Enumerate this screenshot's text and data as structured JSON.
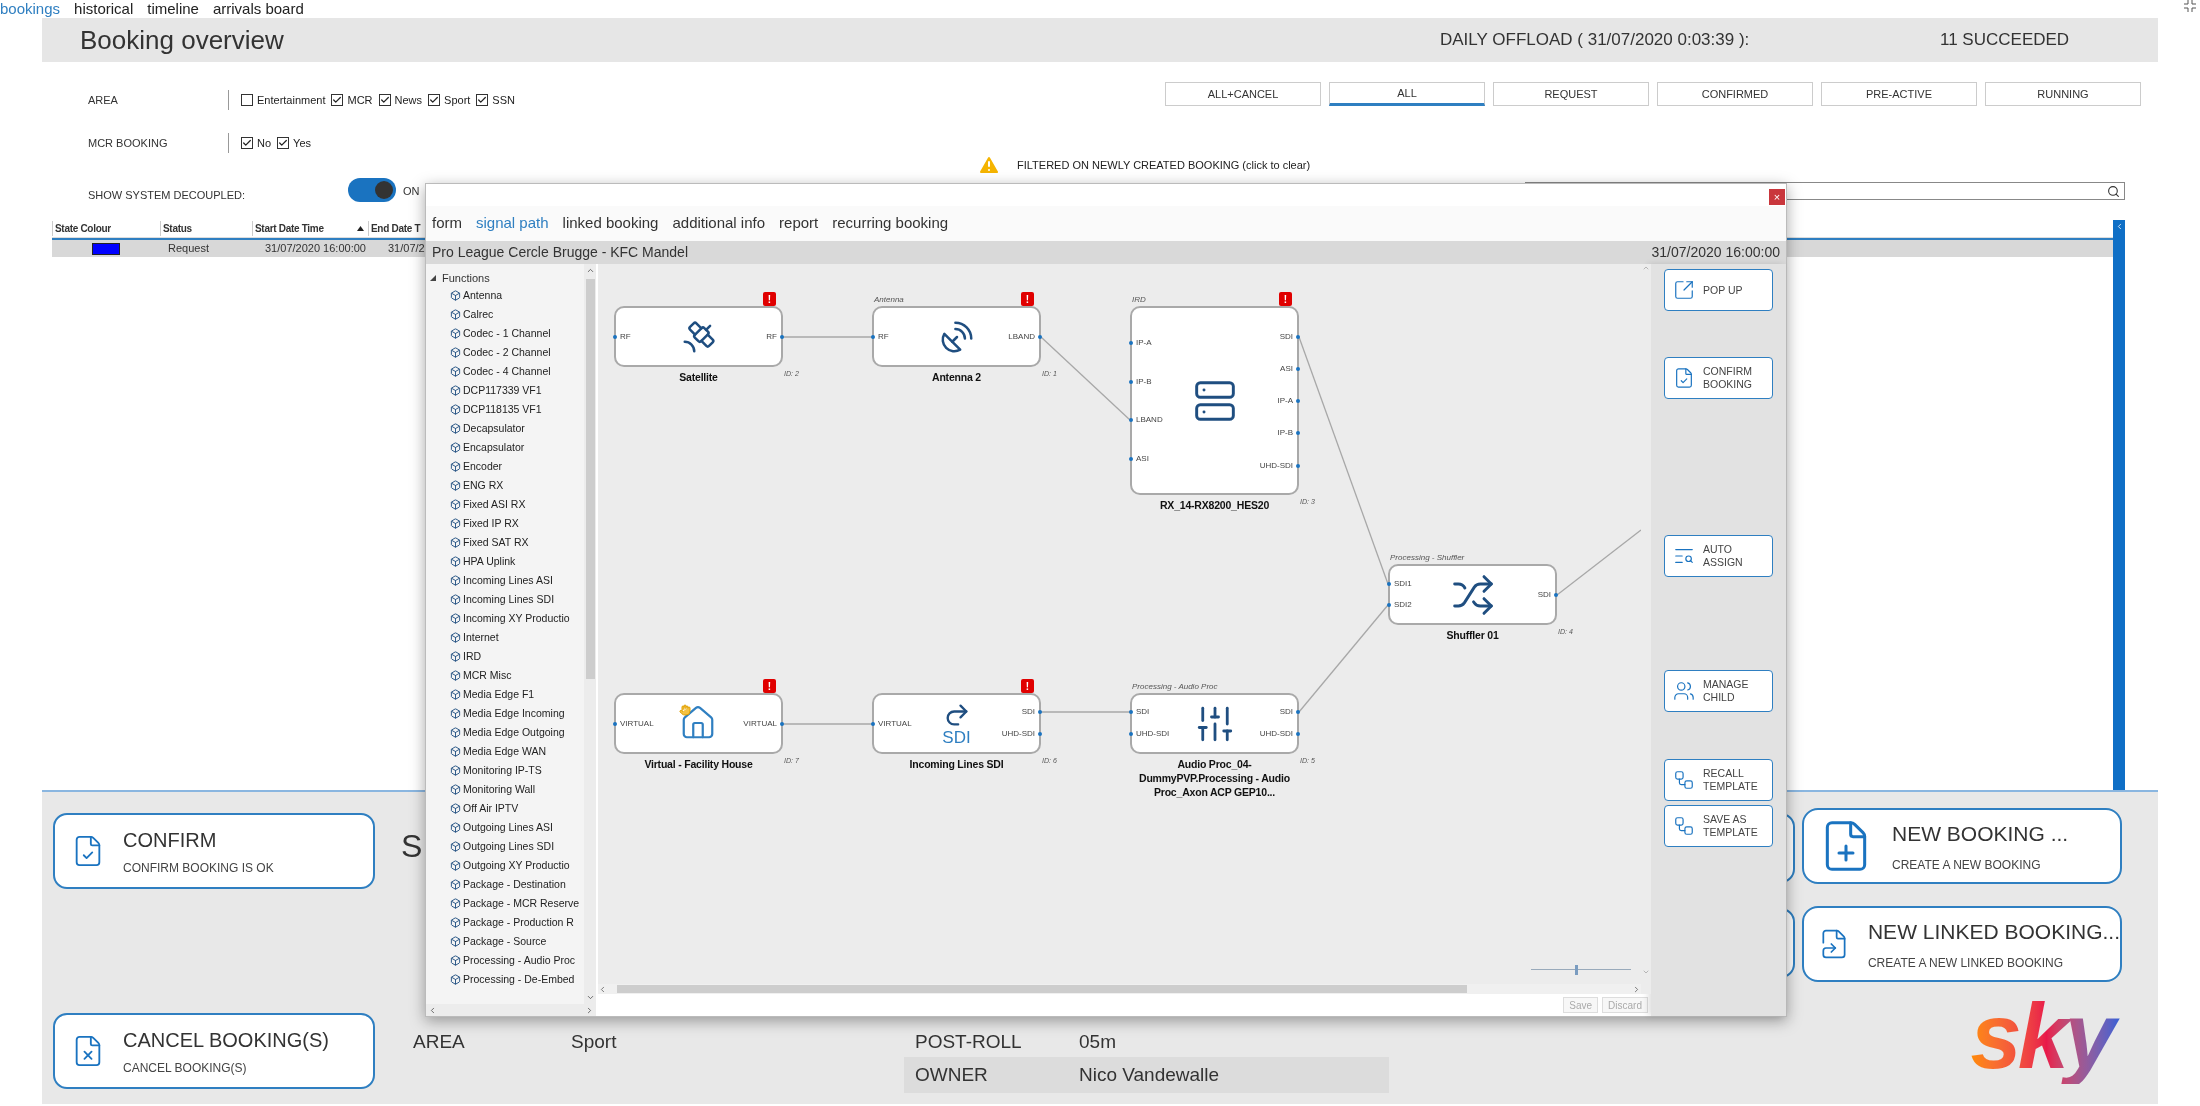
{
  "nav": [
    {
      "label": "bookings",
      "selected": true
    },
    {
      "label": "historical",
      "selected": false
    },
    {
      "label": "timeline",
      "selected": false
    },
    {
      "label": "arrivals board",
      "selected": false
    }
  ],
  "header": {
    "title": "Booking overview",
    "offload": "DAILY OFFLOAD ( 31/07/2020 0:03:39 ):",
    "succeeded": "11 SUCCEEDED"
  },
  "filters": [
    {
      "label": "AREA",
      "options": [
        {
          "label": "Entertainment",
          "checked": false
        },
        {
          "label": "MCR",
          "checked": true
        },
        {
          "label": "News",
          "checked": true
        },
        {
          "label": "Sport",
          "checked": true
        },
        {
          "label": "SSN",
          "checked": true
        }
      ]
    },
    {
      "label": "MCR BOOKING",
      "options": [
        {
          "label": "No",
          "checked": true
        },
        {
          "label": "Yes",
          "checked": true
        }
      ]
    }
  ],
  "decoupled": {
    "label": "SHOW SYSTEM DECOUPLED:",
    "on": true,
    "state_text": "ON"
  },
  "status_tabs": [
    {
      "label": "ALL+CANCEL",
      "selected": false
    },
    {
      "label": "ALL",
      "selected": true
    },
    {
      "label": "REQUEST",
      "selected": false
    },
    {
      "label": "CONFIRMED",
      "selected": false
    },
    {
      "label": "PRE-ACTIVE",
      "selected": false
    },
    {
      "label": "RUNNING",
      "selected": false
    }
  ],
  "notice": "FILTERED ON NEWLY CREATED BOOKING (click to clear)",
  "table": {
    "columns": [
      {
        "label": "State Colour",
        "sorted": false
      },
      {
        "label": "Status",
        "sorted": false
      },
      {
        "label": "Start Date Time",
        "sorted": true
      },
      {
        "label": "End Date T"
      }
    ],
    "rows": [
      {
        "selected": true,
        "cells": [
          {
            "kind": "swatch",
            "color": "#0000ff"
          },
          {
            "kind": "text",
            "text": "Request"
          },
          {
            "kind": "text",
            "text": "31/07/2020 16:00:00"
          },
          {
            "kind": "text",
            "text": "31/07/2"
          }
        ]
      }
    ]
  },
  "actions_left": [
    {
      "kind": "confirm",
      "title": "CONFIRM",
      "subtitle": "CONFIRM BOOKING IS OK"
    },
    {
      "kind": "cancel",
      "title": "CANCEL BOOKING(S)",
      "subtitle": "CANCEL BOOKING(S)"
    }
  ],
  "summary_heading": "S",
  "details": [
    {
      "label": "AREA",
      "value": "Sport"
    },
    {
      "label": "POST-ROLL",
      "value": "05m"
    },
    {
      "label": "OWNER",
      "value": "Nico Vandewalle"
    }
  ],
  "actions_right": [
    {
      "kind": "new",
      "title": "NEW BOOKING ...",
      "subtitle": "CREATE A NEW BOOKING"
    },
    {
      "kind": "linked",
      "title": "NEW LINKED BOOKING...",
      "subtitle": "CREATE A NEW LINKED BOOKING"
    }
  ],
  "logo": "sky",
  "dialog": {
    "close": "×",
    "tabs": [
      {
        "label": "form",
        "selected": false
      },
      {
        "label": "signal path",
        "selected": true
      },
      {
        "label": "linked booking",
        "selected": false
      },
      {
        "label": "additional info",
        "selected": false
      },
      {
        "label": "report",
        "selected": false
      },
      {
        "label": "recurring booking",
        "selected": false
      }
    ],
    "title": "Pro League Cercle Brugge - KFC Mandel",
    "date": "31/07/2020 16:00:00",
    "tree": {
      "label": "Functions",
      "expanded": true,
      "children": [
        {
          "label": "Antenna"
        },
        {
          "label": "Calrec"
        },
        {
          "label": "Codec - 1 Channel"
        },
        {
          "label": "Codec - 2 Channel"
        },
        {
          "label": "Codec - 4 Channel"
        },
        {
          "label": "DCP117339 VF1"
        },
        {
          "label": "DCP118135 VF1"
        },
        {
          "label": "Decapsulator"
        },
        {
          "label": "Encapsulator"
        },
        {
          "label": "Encoder"
        },
        {
          "label": "ENG RX"
        },
        {
          "label": "Fixed ASI RX"
        },
        {
          "label": "Fixed IP RX"
        },
        {
          "label": "Fixed SAT RX"
        },
        {
          "label": "HPA Uplink"
        },
        {
          "label": "Incoming Lines ASI"
        },
        {
          "label": "Incoming Lines SDI"
        },
        {
          "label": "Incoming XY Productio"
        },
        {
          "label": "Internet"
        },
        {
          "label": "IRD"
        },
        {
          "label": "MCR Misc"
        },
        {
          "label": "Media Edge F1"
        },
        {
          "label": "Media Edge Incoming"
        },
        {
          "label": "Media Edge Outgoing"
        },
        {
          "label": "Media Edge WAN"
        },
        {
          "label": "Monitoring IP-TS"
        },
        {
          "label": "Monitoring Wall"
        },
        {
          "label": "Off Air IPTV"
        },
        {
          "label": "Outgoing Lines ASI"
        },
        {
          "label": "Outgoing Lines SDI"
        },
        {
          "label": "Outgoing XY Productio"
        },
        {
          "label": "Package - Destination"
        },
        {
          "label": "Package - MCR Reserve"
        },
        {
          "label": "Package - Production R"
        },
        {
          "label": "Package - Source"
        },
        {
          "label": "Processing - Audio Proc"
        },
        {
          "label": "Processing - De-Embed"
        }
      ]
    },
    "nodes": [
      {
        "kind": "satellite",
        "name": "Satellite",
        "id_label": "ID: 2",
        "badge": "!",
        "inputs": [
          "RF"
        ],
        "outputs": [
          "RF"
        ]
      },
      {
        "kind": "antenna",
        "category": "Antenna",
        "name": "Antenna 2",
        "id_label": "ID: 1",
        "badge": "!",
        "inputs": [
          "RF"
        ],
        "outputs": [
          "LBAND"
        ]
      },
      {
        "kind": "ird",
        "category": "IRD",
        "name": "RX_14-RX8200_HES20",
        "id_label": "ID: 3",
        "badge": "!",
        "inputs": [
          "IP-A",
          "IP-B",
          "LBAND",
          "ASI"
        ],
        "outputs": [
          "SDI",
          "ASI",
          "IP-A",
          "IP-B",
          "UHD-SDI"
        ]
      },
      {
        "kind": "shuffler",
        "category": "Processing - Shuffler",
        "name": "Shuffler 01",
        "id_label": "ID: 4",
        "inputs": [
          "SDI1",
          "SDI2"
        ],
        "outputs": [
          "SDI"
        ]
      },
      {
        "kind": "house",
        "name": "Virtual - Facility House",
        "id_label": "ID: 7",
        "badge": "!",
        "inputs": [
          "VIRTUAL"
        ],
        "outputs": [
          "VIRTUAL"
        ]
      },
      {
        "kind": "incoming",
        "icon_text": "SDI",
        "name": "Incoming Lines SDI",
        "id_label": "ID: 6",
        "badge": "!",
        "inputs": [
          "VIRTUAL"
        ],
        "outputs": [
          "SDI",
          "UHD-SDI"
        ]
      },
      {
        "kind": "audio",
        "category": "Processing - Audio Proc",
        "name": "Audio Proc_04-DummyPVP.Processing - Audio Proc_Axon ACP GEP10...",
        "id_label": "ID: 5",
        "inputs": [
          "SDI",
          "UHD-SDI"
        ],
        "outputs": [
          "SDI",
          "UHD-SDI"
        ]
      }
    ],
    "zoom_slider": {
      "level": 0.45
    },
    "side_buttons": [
      {
        "kind": "popup",
        "label": "POP UP"
      },
      {
        "kind": "confirm",
        "label": "CONFIRM BOOKING"
      },
      {
        "kind": "assign",
        "label": "AUTO ASSIGN"
      },
      {
        "kind": "child",
        "label": "MANAGE CHILD"
      },
      {
        "kind": "recall",
        "label": "RECALL TEMPLATE"
      },
      {
        "kind": "save",
        "label": "SAVE AS TEMPLATE"
      }
    ],
    "footer_buttons": [
      {
        "label": "Save",
        "disabled": true
      },
      {
        "label": "Discard",
        "disabled": true
      }
    ]
  }
}
